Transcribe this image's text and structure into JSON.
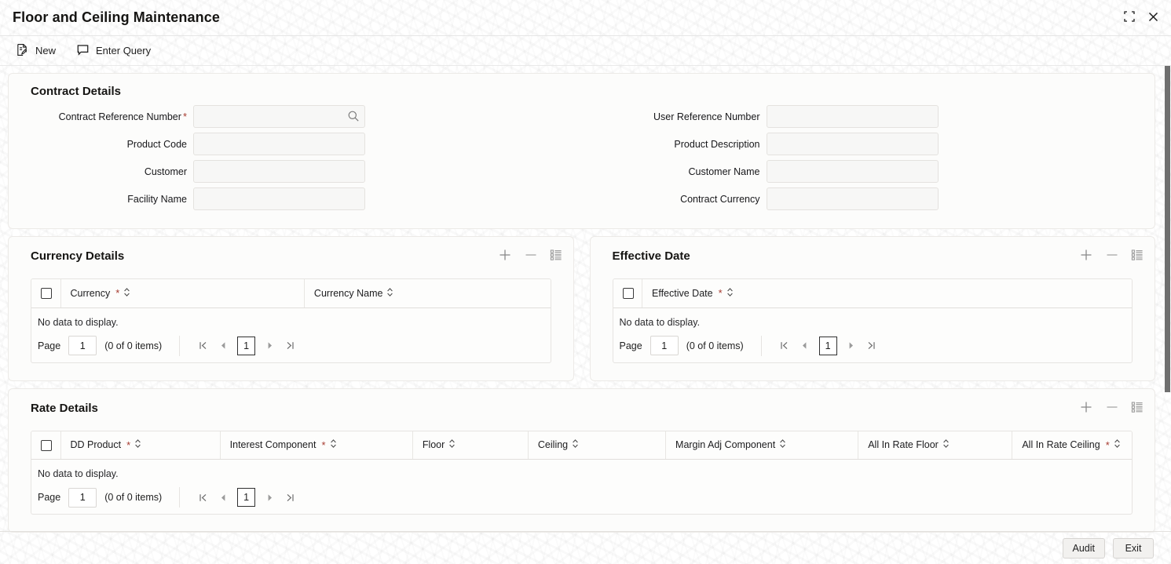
{
  "window": {
    "title": "Floor and Ceiling Maintenance",
    "minimize_icon": "collapse-icon",
    "close_icon": "close-icon"
  },
  "toolbar": {
    "new_label": "New",
    "enter_query_label": "Enter Query"
  },
  "contract_details": {
    "title": "Contract Details",
    "left_fields": [
      {
        "label": "Contract Reference Number",
        "required": true,
        "value": "",
        "placeholder": "",
        "has_search": true
      },
      {
        "label": "Product Code",
        "required": false,
        "value": "",
        "placeholder": "",
        "has_search": false
      },
      {
        "label": "Customer",
        "required": false,
        "value": "",
        "placeholder": "",
        "has_search": false
      },
      {
        "label": "Facility Name",
        "required": false,
        "value": "",
        "placeholder": "",
        "has_search": false
      }
    ],
    "right_fields": [
      {
        "label": "User Reference Number",
        "required": false,
        "value": "",
        "placeholder": "",
        "has_search": false
      },
      {
        "label": "Product Description",
        "required": false,
        "value": "",
        "placeholder": "",
        "has_search": false
      },
      {
        "label": "Customer Name",
        "required": false,
        "value": "",
        "placeholder": "",
        "has_search": false
      },
      {
        "label": "Contract Currency",
        "required": false,
        "value": "",
        "placeholder": "",
        "has_search": false
      }
    ]
  },
  "currency_details": {
    "title": "Currency Details",
    "tools": [
      "add-icon",
      "remove-icon",
      "list-view-icon"
    ],
    "columns": [
      {
        "label": "Currency",
        "required": true,
        "sortable": true
      },
      {
        "label": "Currency Name",
        "required": false,
        "sortable": true
      }
    ],
    "empty_text": "No data to display.",
    "pager": {
      "page_label": "Page",
      "page_value": "1",
      "count_text": "(0 of 0 items)",
      "current_page": "1",
      "first_icon": "first-page-icon",
      "prev_icon": "previous-page-icon",
      "next_icon": "next-page-icon",
      "last_icon": "last-page-icon"
    }
  },
  "effective_date": {
    "title": "Effective Date",
    "tools": [
      "add-icon",
      "remove-icon",
      "list-view-icon"
    ],
    "columns": [
      {
        "label": "Effective Date",
        "required": true,
        "sortable": true
      }
    ],
    "empty_text": "No data to display.",
    "pager": {
      "page_label": "Page",
      "page_value": "1",
      "count_text": "(0 of 0 items)",
      "current_page": "1",
      "first_icon": "first-page-icon",
      "prev_icon": "previous-page-icon",
      "next_icon": "next-page-icon",
      "last_icon": "last-page-icon"
    }
  },
  "rate_details": {
    "title": "Rate Details",
    "tools": [
      "add-icon",
      "remove-icon",
      "list-view-icon"
    ],
    "columns": [
      {
        "label": "DD Product",
        "required": true,
        "sortable": true
      },
      {
        "label": "Interest Component",
        "required": true,
        "sortable": true
      },
      {
        "label": "Floor",
        "required": false,
        "sortable": true
      },
      {
        "label": "Ceiling",
        "required": false,
        "sortable": true
      },
      {
        "label": "Margin Adj Component",
        "required": false,
        "sortable": true
      },
      {
        "label": "All In Rate Floor",
        "required": false,
        "sortable": true
      },
      {
        "label": "All In Rate Ceiling",
        "required": true,
        "sortable": true
      }
    ],
    "empty_text": "No data to display.",
    "pager": {
      "page_label": "Page",
      "page_value": "1",
      "count_text": "(0 of 0 items)",
      "current_page": "1",
      "first_icon": "first-page-icon",
      "prev_icon": "previous-page-icon",
      "next_icon": "next-page-icon",
      "last_icon": "last-page-icon"
    }
  },
  "footer": {
    "audit_label": "Audit",
    "exit_label": "Exit"
  },
  "colors": {
    "required_asterisk": "#a63a2f",
    "title_text": "#161513",
    "field_background": "#f7f7f6",
    "card_background": "#fcfcfb",
    "scrollbar_thumb": "#6f6f6f"
  }
}
